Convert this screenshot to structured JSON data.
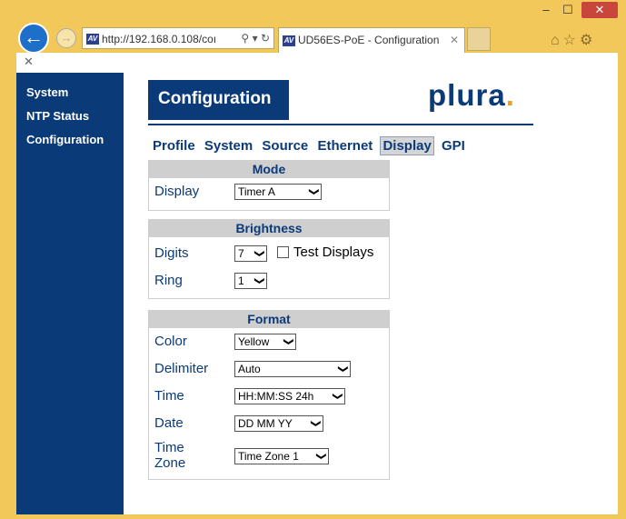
{
  "browser": {
    "address_url": "http://192.168.0.108/coı",
    "tab_title": "UD56ES-PoE - Configuration",
    "favicon_text": "AV"
  },
  "sidebar": {
    "items": [
      {
        "label": "System"
      },
      {
        "label": "NTP Status"
      },
      {
        "label": "Configuration"
      }
    ]
  },
  "header": {
    "title": "Configuration",
    "logo": "plura",
    "logo_dot": "."
  },
  "tabs": [
    {
      "label": "Profile"
    },
    {
      "label": "System"
    },
    {
      "label": "Source"
    },
    {
      "label": "Ethernet"
    },
    {
      "label": "Display",
      "active": true
    },
    {
      "label": "GPI"
    }
  ],
  "mode": {
    "title": "Mode",
    "display_label": "Display",
    "display_value": "Timer A"
  },
  "brightness": {
    "title": "Brightness",
    "digits_label": "Digits",
    "digits_value": "7",
    "test_displays_label": "Test Displays",
    "ring_label": "Ring",
    "ring_value": "1"
  },
  "format": {
    "title": "Format",
    "color_label": "Color",
    "color_value": "Yellow",
    "delimiter_label": "Delimiter",
    "delimiter_value": "Auto",
    "time_label": "Time",
    "time_value": "HH:MM:SS 24h",
    "date_label": "Date",
    "date_value": "DD MM YY",
    "timezone_label_1": "Time",
    "timezone_label_2": "Zone",
    "timezone_value": "Time Zone 1"
  },
  "colors": {
    "navy": "#0b3a78",
    "frame": "#f3c85a",
    "panel_header": "#cfcfcf"
  }
}
